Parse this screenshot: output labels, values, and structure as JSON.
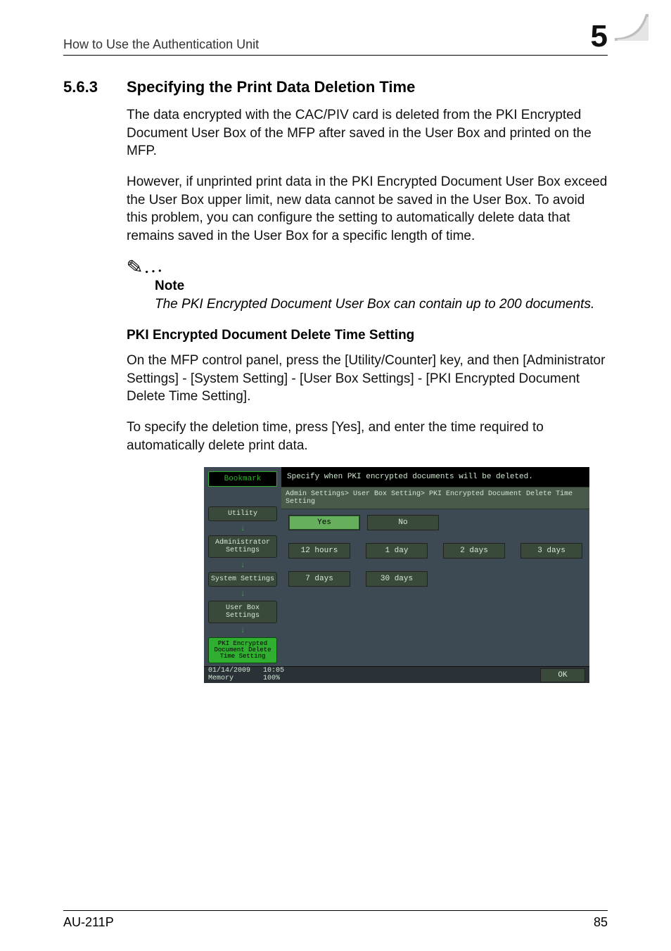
{
  "header": {
    "left": "How to Use the Authentication Unit",
    "chapter": "5"
  },
  "section": {
    "num": "5.6.3",
    "title": "Specifying the Print Data Deletion Time"
  },
  "para1": "The data encrypted with the CAC/PIV card is deleted from the PKI Encrypted Document User Box of the MFP after saved in the User Box and printed on the MFP.",
  "para2": "However, if unprinted print data in the PKI Encrypted Document User Box exceed the User Box upper limit, new data cannot be saved in the User Box. To avoid this problem, you can configure the setting to automatically delete data that remains saved in the User Box for a specific length of time.",
  "note": {
    "icon": "✎…",
    "label": "Note",
    "text": "The PKI Encrypted Document User Box can contain up to 200 documents."
  },
  "sub_heading": "PKI Encrypted Document Delete Time Setting",
  "para3": "On the MFP control panel, press the [Utility/Counter] key, and then [Administrator Settings] - [System Setting] - [User Box Settings] - [PKI Encrypted Document Delete Time Setting].",
  "para4": "To specify the deletion time, press [Yes], and enter the time required to automatically delete print data.",
  "panel": {
    "instruction": "Specify when PKI encrypted documents will be deleted.",
    "breadcrumb": "Admin Settings> User Box Setting> PKI Encrypted Document Delete Time Setting",
    "yes": "Yes",
    "no": "No",
    "options_row1": [
      "12 hours",
      "1 day",
      "2 days",
      "3 days"
    ],
    "options_row2": [
      "7 days",
      "30 days"
    ],
    "left_nav": {
      "bookmark": "Bookmark",
      "items": [
        "Utility",
        "Administrator\nSettings",
        "System Settings",
        "User Box\nSettings",
        "PKI Encrypted\nDocument Delete\nTime Setting"
      ]
    },
    "bottom": {
      "date": "01/14/2009",
      "time": "10:05",
      "mem_label": "Memory",
      "mem_value": "100%",
      "ok": "OK"
    }
  },
  "footer": {
    "left": "AU-211P",
    "right": "85"
  }
}
